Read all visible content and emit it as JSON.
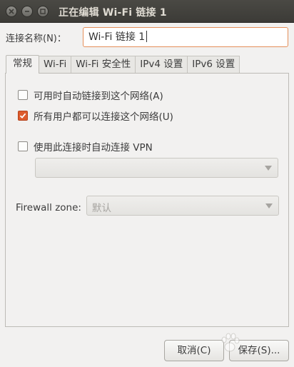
{
  "window": {
    "title": "正在编辑 Wi-Fi 链接 1",
    "title_color": "#dfdbd2",
    "titlebar_color": "#3c3b37"
  },
  "connection": {
    "name_label": "连接名称(N)：",
    "name_value": "Wi-Fi 链接 1"
  },
  "tabs": [
    {
      "label": "常规",
      "active": true
    },
    {
      "label": "Wi-Fi",
      "active": false
    },
    {
      "label": "Wi-Fi 安全性",
      "active": false
    },
    {
      "label": "IPv4 设置",
      "active": false
    },
    {
      "label": "IPv6 设置",
      "active": false
    }
  ],
  "general": {
    "auto_connect": {
      "label": "可用时自动链接到这个网络(A)",
      "checked": false
    },
    "all_users": {
      "label": "所有用户都可以连接这个网络(U)",
      "checked": true
    },
    "auto_vpn": {
      "label": "使用此连接时自动连接 VPN",
      "checked": false
    },
    "vpn_select_value": "",
    "firewall_label": "Firewall zone:",
    "firewall_value": "默认"
  },
  "buttons": {
    "cancel": "取消(C)",
    "save": "保存(S)..."
  },
  "colors": {
    "accent": "#dd5b2c",
    "input_focus": "#e58f5a",
    "background": "#f2f1f0"
  }
}
